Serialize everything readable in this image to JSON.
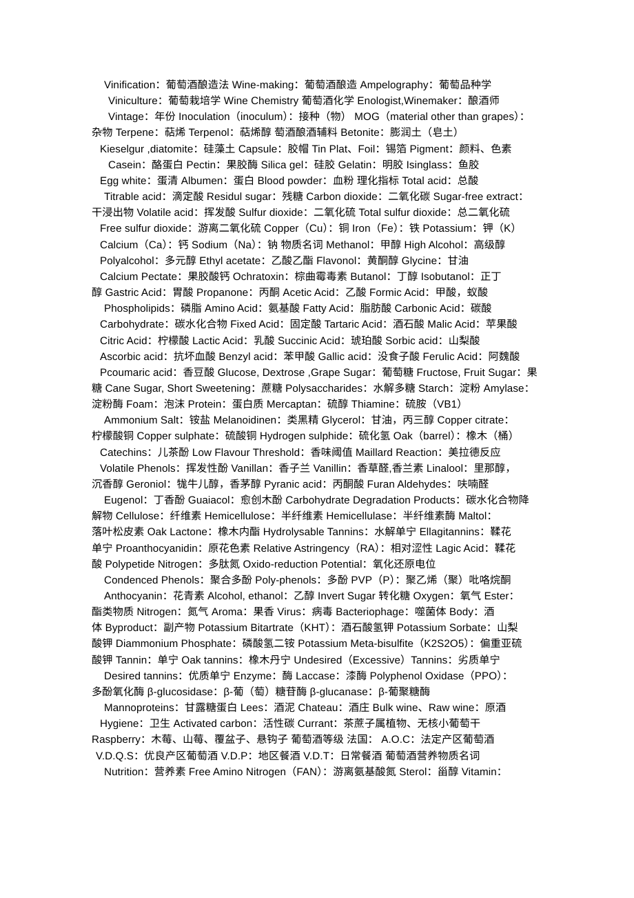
{
  "document": {
    "title": "Wine Terminology Glossary",
    "page_background": "#ffffff",
    "text_color": "#000000",
    "lines": [
      {
        "id": 1,
        "indent": "indent-a",
        "text": "Vinification：葡萄酒酿造法  Wine-making：葡萄酒酿造  Ampelography：葡萄品种学"
      },
      {
        "id": 2,
        "indent": "indent-c",
        "text": "Viniculture：葡萄栽培学  Wine Chemistry 葡萄酒化学  Enologist,Winemaker：酿酒师"
      },
      {
        "id": 3,
        "indent": "indent-c",
        "text": "Vintage：年份   Inoculation（inoculum）：接种（物）   MOG（material other than grapes）："
      },
      {
        "id": 4,
        "indent": "flush",
        "text": "杂物  Terpene：萜烯  Terpenol：萜烯醇  萄酒酿酒辅料   Betonite：膨润土（皂土）"
      },
      {
        "id": 5,
        "indent": "indent-b",
        "text": "Kieselgur ,diatomite：硅藻土  Capsule：胶帽  Tin Plat、Foil：锡箔  Pigment：颜料、色素"
      },
      {
        "id": 6,
        "indent": "indent-c",
        "text": "Casein：酪蛋白  Pectin：果胶酶  Silica gel：硅胶  Gelatin：明胶  Isinglass：鱼胶"
      },
      {
        "id": 7,
        "indent": "indent-b",
        "text": "Egg white：蛋清  Albumen：蛋白  Blood powder：血粉 理化指标  Total acid：总酸"
      },
      {
        "id": 8,
        "indent": "indent-a",
        "text": "Titrable acid：滴定酸  Residul sugar：残糖  Carbon dioxide：二氧化碳  Sugar-free extract："
      },
      {
        "id": 9,
        "indent": "flush",
        "text": "干浸出物  Volatile acid：挥发酸  Sulfur dioxide：二氧化硫  Total sulfur dioxide：总二氧化硫"
      },
      {
        "id": 10,
        "indent": "indent-b",
        "text": "Free sulfur dioxide：游离二氧化硫  Copper（Cu）：铜  Iron（Fe）：铁  Potassium：钾（K）"
      },
      {
        "id": 11,
        "indent": "indent-b",
        "text": "Calcium（Ca）：钙   Sodium（Na）：钠  物质名词  Methanol：甲醇  High Alcohol：高级醇"
      },
      {
        "id": 12,
        "indent": "indent-b",
        "text": "Polyalcohol：多元醇  Ethyl acetate：乙酸乙酯  Flavonol：黄酮醇  Glycine：甘油"
      },
      {
        "id": 13,
        "indent": "indent-b",
        "text": "Calcium Pectate：果胶酸钙  Ochratoxin：棕曲霉毒素  Butanol：丁醇  Isobutanol：正丁"
      },
      {
        "id": 14,
        "indent": "flush",
        "text": "醇  Gastric Acid：胃酸  Propanone：丙酮  Acetic Acid：乙酸  Formic Acid：甲酸，蚁酸"
      },
      {
        "id": 15,
        "indent": "indent-a",
        "text": "Phospholipids：磷脂   Amino Acid：氨基酸  Fatty Acid：脂肪酸  Carbonic Acid：碳酸"
      },
      {
        "id": 16,
        "indent": "indent-b",
        "text": "Carbohydrate：碳水化合物  Fixed Acid：固定酸  Tartaric Acid：酒石酸  Malic Acid：苹果酸"
      },
      {
        "id": 17,
        "indent": "indent-b",
        "text": "Citric Acid：柠檬酸  Lactic Acid：乳酸  Succinic Acid：琥珀酸  Sorbic acid：山梨酸"
      },
      {
        "id": 18,
        "indent": "indent-b",
        "text": "Ascorbic acid：抗坏血酸  Benzyl acid：苯甲酸  Gallic acid：没食子酸  Ferulic Acid：阿魏酸"
      },
      {
        "id": 19,
        "indent": "indent-b",
        "text": "Pcoumaric acid：香豆酸  Glucose, Dextrose ,Grape Sugar：葡萄糖  Fructose, Fruit Sugar：果"
      },
      {
        "id": 20,
        "indent": "flush",
        "text": "糖  Cane Sugar, Short Sweetening：蔗糖  Polysaccharides：水解多糖  Starch：淀粉  Amylase："
      },
      {
        "id": 21,
        "indent": "flush",
        "text": "淀粉酶  Foam：泡沫  Protein：蛋白质  Mercaptan：硫醇  Thiamine：硫胺（VB1）"
      },
      {
        "id": 22,
        "indent": "indent-a",
        "text": "Ammonium Salt：铵盐  Melanoidinen：类黑精  Glycerol：甘油，丙三醇  Copper citrate："
      },
      {
        "id": 23,
        "indent": "flush",
        "text": "柠檬酸铜  Copper sulphate：硫酸铜  Hydrogen sulphide：硫化氢  Oak（barrel）：橡木（桶）"
      },
      {
        "id": 24,
        "indent": "indent-b",
        "text": "Catechins：儿茶酚  Low Flavour Threshold：香味阈值  Maillard Reaction：美拉德反应"
      },
      {
        "id": 25,
        "indent": "indent-b",
        "text": "Volatile Phenols：挥发性酚  Vanillan：香子兰  Vanillin：香草醛,香兰素  Linalool：里那醇，"
      },
      {
        "id": 26,
        "indent": "flush",
        "text": "沉香醇  Geroniol：牻牛儿醇，香茅醇  Pyranic acid：丙酮酸  Furan Aldehydes：呋喃醛"
      },
      {
        "id": 27,
        "indent": "indent-a",
        "text": "Eugenol：丁香酚  Guaiacol：愈创木酚  Carbohydrate Degradation Products：碳水化合物降"
      },
      {
        "id": 28,
        "indent": "flush",
        "text": "解物  Cellulose：纤维素  Hemicellulose：半纤维素  Hemicellulase：半纤维素酶  Maltol："
      },
      {
        "id": 29,
        "indent": "flush",
        "text": "落叶松皮素  Oak Lactone：橡木内酯  Hydrolysable Tannins：水解单宁  Ellagitannins：鞣花"
      },
      {
        "id": 30,
        "indent": "flush",
        "text": "单宁  Proanthocyanidin：原花色素  Relative Astringency（RA）：相对涩性  Lagic Acid：鞣花"
      },
      {
        "id": 31,
        "indent": "flush",
        "text": "酸   Polypetide Nitrogen：多肽氮  Oxido-reduction Potential：氧化还原电位"
      },
      {
        "id": 32,
        "indent": "indent-a",
        "text": "Condenced Phenols：聚合多酚  Poly-phenols：多酚  PVP（P）：聚乙烯（聚）吡咯烷酮"
      },
      {
        "id": 33,
        "indent": "indent-a",
        "text": "Anthocyanin：花青素  Alcohol, ethanol：乙醇  Invert Sugar 转化糖  Oxygen：氧气  Ester："
      },
      {
        "id": 34,
        "indent": "flush",
        "text": "酯类物质  Nitrogen：氮气  Aroma：果香  Virus：病毒  Bacteriophage：噬菌体  Body：酒"
      },
      {
        "id": 35,
        "indent": "flush",
        "text": "体  Byproduct：副产物  Potassium Bitartrate（KHT）：酒石酸氢钾  Potassium Sorbate：山梨"
      },
      {
        "id": 36,
        "indent": "flush",
        "text": "酸钾  Diammonium Phosphate：磷酸氢二铵  Potassium Meta-bisulfite（K2S2O5）：偏重亚硫"
      },
      {
        "id": 37,
        "indent": "flush",
        "text": "酸钾  Tannin：单宁  Oak tannins：橡木丹宁  Undesired（Excessive）Tannins：劣质单宁"
      },
      {
        "id": 38,
        "indent": "indent-a",
        "text": "Desired tannins：优质单宁  Enzyme：酶  Laccase：漆酶  Polyphenol Oxidase（PPO）："
      },
      {
        "id": 39,
        "indent": "flush",
        "text": "多酚氧化酶   β-glucosidase：β-葡（萄）糖苷酶  β-glucanase：β-葡聚糖酶"
      },
      {
        "id": 40,
        "indent": "indent-a",
        "text": "Mannoproteins：甘露糖蛋白  Lees：酒泥  Chateau：酒庄  Bulk wine、Raw wine：原酒"
      },
      {
        "id": 41,
        "indent": "indent-b",
        "text": "Hygiene：卫生  Activated carbon：活性碳  Currant：茶蔗子属植物、无核小葡萄干"
      },
      {
        "id": 42,
        "indent": "flush",
        "text": "Raspberry：木莓、山莓、覆盆子、悬钩子  葡萄酒等级   法国：   A.O.C：法定产区葡萄酒"
      },
      {
        "id": 43,
        "indent": "indent-d",
        "text": "V.D.Q.S：优良产区葡萄酒  V.D.P：地区餐酒  V.D.T：日常餐酒 葡萄酒营养物质名词"
      },
      {
        "id": 44,
        "indent": "indent-a",
        "text": "Nutrition：营养素  Free Amino Nitrogen（FAN）：游离氨基酸氮  Sterol：甾醇  Vitamin："
      }
    ]
  }
}
